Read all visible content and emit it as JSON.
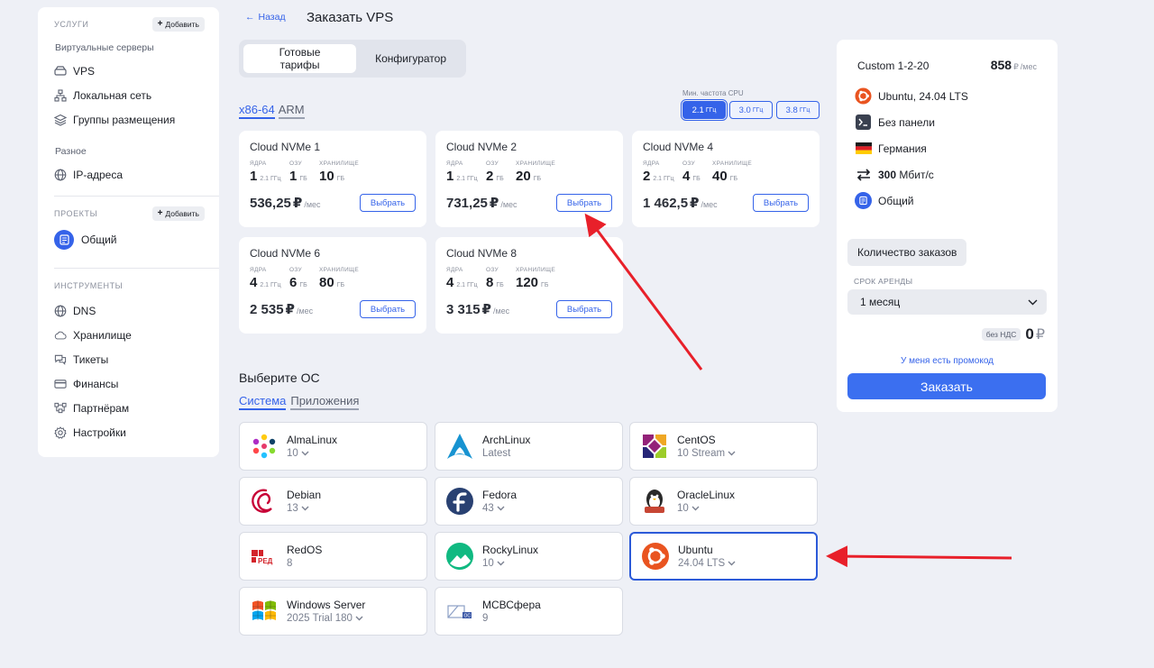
{
  "sidebar": {
    "services_caption": "УСЛУГИ",
    "add_label": "Добавить",
    "virtual_servers_caption": "Виртуальные серверы",
    "items_main": [
      {
        "label": "VPS",
        "icon": "server-icon"
      },
      {
        "label": "Локальная сеть",
        "icon": "network-icon"
      },
      {
        "label": "Группы размещения",
        "icon": "layers-icon"
      }
    ],
    "misc_caption": "Разное",
    "ip_label": "IP-адреса",
    "projects_caption": "ПРОЕКТЫ",
    "project_name": "Общий",
    "tools_caption": "ИНСТРУМЕНТЫ",
    "tools": [
      {
        "label": "DNS",
        "icon": "globe-icon"
      },
      {
        "label": "Хранилище",
        "icon": "cloud-icon"
      },
      {
        "label": "Тикеты",
        "icon": "chat-icon"
      },
      {
        "label": "Финансы",
        "icon": "card-icon"
      },
      {
        "label": "Партнёрам",
        "icon": "partners-icon"
      },
      {
        "label": "Настройки",
        "icon": "gear-icon"
      }
    ]
  },
  "header": {
    "back_label": "Назад",
    "title": "Заказать VPS"
  },
  "segment": {
    "ready": "Готовые тарифы",
    "configurator": "Конфигуратор"
  },
  "arch": {
    "x86": "x86-64",
    "arm": "ARM"
  },
  "cpu": {
    "caption": "Мин. частота CPU",
    "options": [
      {
        "value": "2.1",
        "unit": "ГГц"
      },
      {
        "value": "3.0",
        "unit": "ГГц"
      },
      {
        "value": "3.8",
        "unit": "ГГц"
      }
    ]
  },
  "spec_captions": {
    "cores": "ЯДРА",
    "ram": "ОЗУ",
    "storage": "ХРАНИЛИЩЕ"
  },
  "ghz": "2.1 ГГц",
  "gb": "ГБ",
  "per_month": "/мес",
  "ruble": "₽",
  "pick_label": "Выбрать",
  "plans": [
    {
      "name": "Cloud NVMe 1",
      "cores": "1",
      "ram": "1",
      "storage": "10",
      "price": "536,25"
    },
    {
      "name": "Cloud NVMe 2",
      "cores": "1",
      "ram": "2",
      "storage": "20",
      "price": "731,25"
    },
    {
      "name": "Cloud NVMe 4",
      "cores": "2",
      "ram": "4",
      "storage": "40",
      "price": "1 462,5"
    },
    {
      "name": "Cloud NVMe 6",
      "cores": "4",
      "ram": "6",
      "storage": "80",
      "price": "2 535"
    },
    {
      "name": "Cloud NVMe 8",
      "cores": "4",
      "ram": "8",
      "storage": "120",
      "price": "3 315"
    }
  ],
  "os": {
    "title": "Выберите ОС",
    "tab_system": "Система",
    "tab_apps": "Приложения",
    "items": [
      {
        "name": "AlmaLinux",
        "version": "10",
        "icon": "almalinux-icon"
      },
      {
        "name": "ArchLinux",
        "version": "Latest",
        "icon": "archlinux-icon"
      },
      {
        "name": "CentOS",
        "version": "10 Stream",
        "icon": "centos-icon"
      },
      {
        "name": "Debian",
        "version": "13",
        "icon": "debian-icon"
      },
      {
        "name": "Fedora",
        "version": "43",
        "icon": "fedora-icon"
      },
      {
        "name": "OracleLinux",
        "version": "10",
        "icon": "oraclelinux-icon"
      },
      {
        "name": "RedOS",
        "version": "8",
        "icon": "redos-icon"
      },
      {
        "name": "RockyLinux",
        "version": "10",
        "icon": "rockylinux-icon"
      },
      {
        "name": "Ubuntu",
        "version": "24.04 LTS",
        "icon": "ubuntu-icon"
      },
      {
        "name": "Windows Server",
        "version": "2025 Trial 180",
        "icon": "windows-icon"
      },
      {
        "name": "МСВСфера",
        "version": "9",
        "icon": "msvsphere-icon"
      }
    ],
    "redos_logo_text": "РЕД",
    "msvs_logo_text": "OC"
  },
  "summary": {
    "plan": "Custom 1-2-20",
    "price": "858",
    "os": "Ubuntu, 24.04 LTS",
    "panel": "Без панели",
    "location": "Германия",
    "bandwidth_value": "300",
    "bandwidth_unit": "Мбит/с",
    "project": "Общий",
    "qty_label": "Количество заказов",
    "rent_caption": "СРОК АРЕНДЫ",
    "rent_value": "1 месяц",
    "vat_label": "без НДС",
    "total": "0",
    "promo": "У меня есть промокод",
    "order_label": "Заказать"
  },
  "colors": {
    "accent": "#3563e9",
    "annotation_arrow": "#e8202a",
    "ubuntu": "#e95420"
  }
}
